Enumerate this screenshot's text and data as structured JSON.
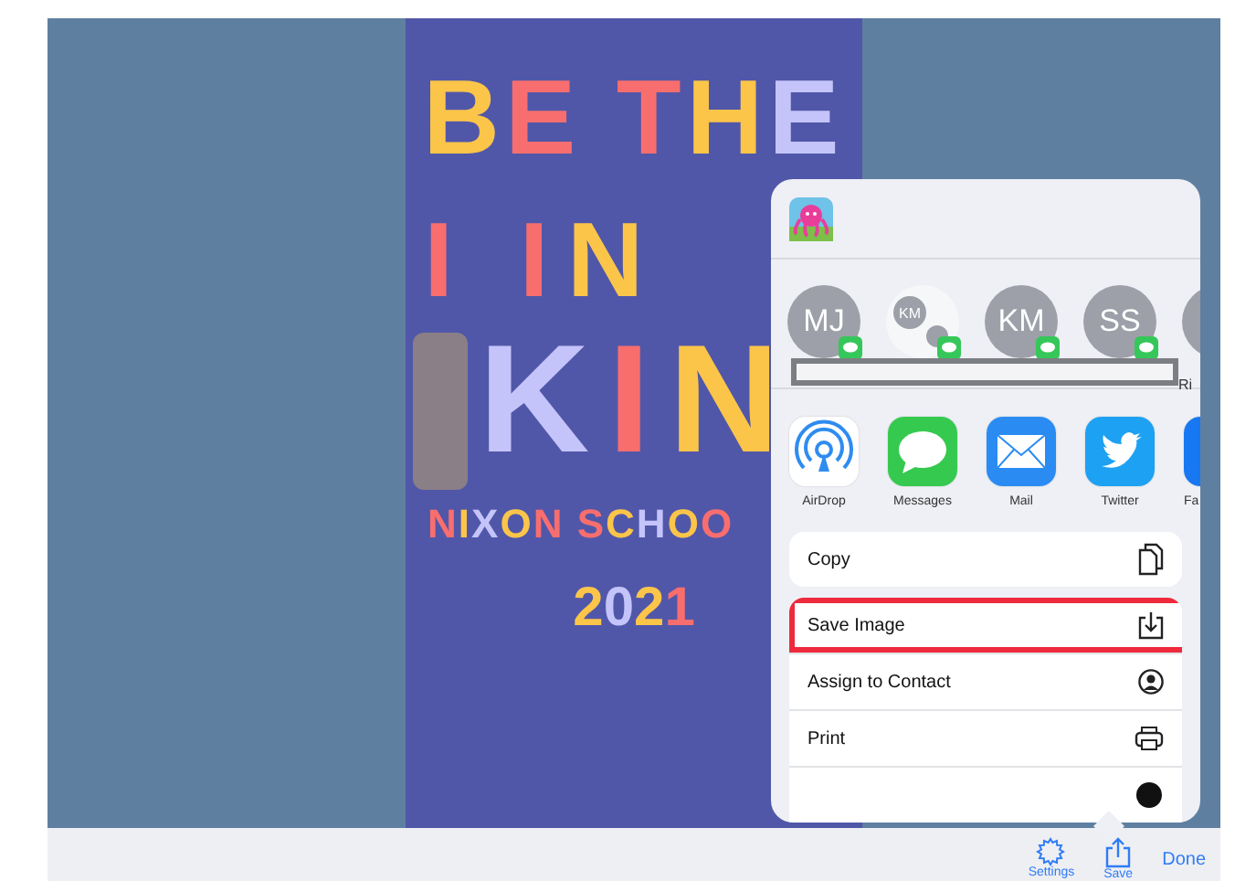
{
  "poster": {
    "lines": [
      "BE THE",
      "I IN",
      "KIN",
      "NIXON SCHOO",
      "2021"
    ]
  },
  "share_sheet": {
    "contacts": [
      {
        "initials": "MJ",
        "kind": "person"
      },
      {
        "initials": "KM",
        "kind": "group"
      },
      {
        "initials": "KM",
        "kind": "person"
      },
      {
        "initials": "SS",
        "kind": "person"
      },
      {
        "kind": "partial",
        "label": "Ri"
      }
    ],
    "apps": [
      {
        "label": "AirDrop",
        "kind": "airdrop"
      },
      {
        "label": "Messages",
        "kind": "messages"
      },
      {
        "label": "Mail",
        "kind": "mail"
      },
      {
        "label": "Twitter",
        "kind": "twitter"
      },
      {
        "label": "Fa",
        "kind": "partial"
      }
    ],
    "actions": [
      {
        "label": "Copy",
        "kind": "copy",
        "highlighted": false
      },
      {
        "label": "Save Image",
        "kind": "save",
        "highlighted": true
      },
      {
        "label": "Assign to Contact",
        "kind": "contact",
        "highlighted": false
      },
      {
        "label": "Print",
        "kind": "print",
        "highlighted": false
      },
      {
        "kind": "partial",
        "highlighted": false
      }
    ]
  },
  "toolbar": {
    "buttons": [
      {
        "label": "Settings",
        "kind": "settings"
      },
      {
        "label": "Save",
        "kind": "share"
      },
      {
        "label": "Done",
        "kind": "text"
      }
    ]
  }
}
